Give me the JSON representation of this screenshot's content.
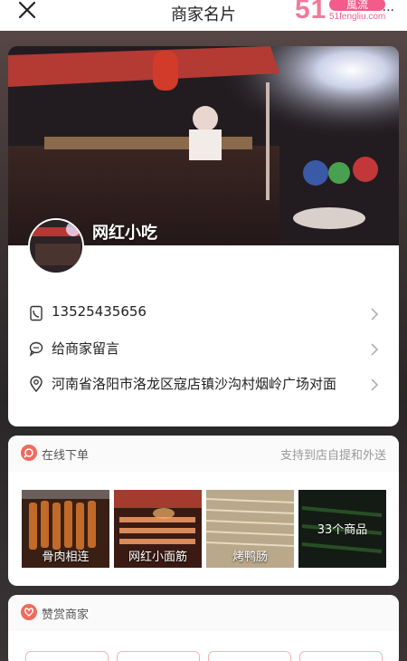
{
  "header": {
    "title": "商家名片",
    "logo_number": "51",
    "logo_badge": "風流",
    "logo_url": "51fengliu.com",
    "close_icon": "close-icon",
    "more_icon": "more-icon"
  },
  "merchant": {
    "name": "网红小吃",
    "phone": "13525435656",
    "message_label": "给商家留言",
    "address": "河南省洛阳市洛龙区寇店镇沙沟村烟岭广场对面"
  },
  "order": {
    "title": "在线下单",
    "subtitle": "支持到店自提和外送",
    "products": [
      {
        "name": "骨肉相连"
      },
      {
        "name": "网红小面筋"
      },
      {
        "name": "烤鸭肠"
      }
    ],
    "more_count": "33个商品"
  },
  "praise": {
    "title": "赞赏商家"
  },
  "colors": {
    "accent": "#f06a5e",
    "logo_pink": "#f25b8a"
  }
}
